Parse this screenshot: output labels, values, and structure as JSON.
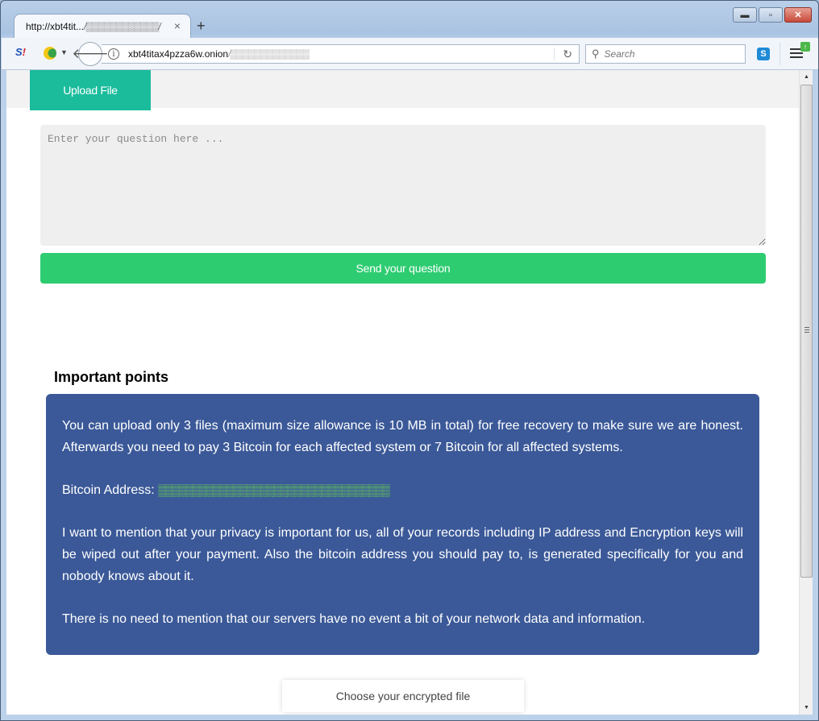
{
  "browser": {
    "tab": {
      "title_prefix": "http://xbt4tit...",
      "title_obscured": "/▒▒▒▒▒▒▒▒▒▒▒▒/",
      "close_icon": "×"
    },
    "new_tab_icon": "+",
    "window_controls": {
      "minimize": "▬",
      "maximize": "▫",
      "close": "✕"
    },
    "toolbar": {
      "s_logo_text": "S",
      "s_logo_mark": "!",
      "back_icon": "🡐",
      "info_icon": "i",
      "url_host": "xbt4titax4pzza6w.onion",
      "url_obscured": "/▒▒▒▒▒▒▒▒▒▒▒▒▒",
      "reload_icon": "↻",
      "search_placeholder": "Search",
      "search_icon": "⚲",
      "skype_label": "S",
      "update_badge": "↑"
    }
  },
  "page": {
    "upload_tab_label": "Upload File",
    "question_placeholder": "Enter your question here ...",
    "send_button_label": "Send your question",
    "important_title": "Important points",
    "paragraphs": {
      "p1": "You can upload only 3 files (maximum size allowance is 10 MB in total) for free recovery to make sure we are honest. Afterwards you need to pay 3 Bitcoin for each affected system or 7 Bitcoin for all affected systems.",
      "btc_label": "Bitcoin Address:",
      "btc_value_obscured": "▒▒▒▒▒▒▒▒▒▒▒▒▒▒▒▒▒▒▒▒▒▒▒▒▒▒▒▒▒▒▒▒▒▒",
      "p3": "I want to mention that your privacy is important for us, all of your records including IP address and Encryption keys will be wiped out after your payment. Also the bitcoin address you should pay to, is generated specifically for you and nobody knows about it.",
      "p4": "There is no need to mention that our servers have no event a bit of your network data and information."
    },
    "choose_file_label": "Choose your encrypted file"
  },
  "scrollbar": {
    "up_icon": "▲",
    "down_icon": "▼",
    "position_fraction": 0.0,
    "visible_fraction": 0.78
  },
  "colors": {
    "upload_tab": "#1abc9c",
    "send_button": "#2ecc71",
    "points_box": "#3b5998",
    "btc_address": "#6fe34a"
  }
}
